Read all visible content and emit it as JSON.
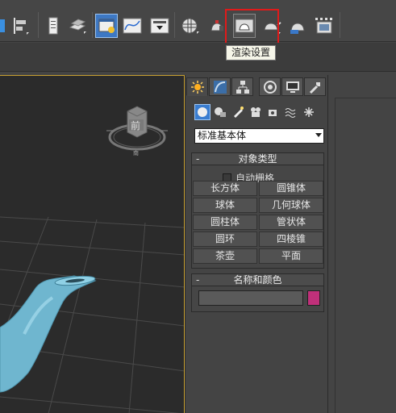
{
  "toolbar": {
    "tooltip": "渲染设置",
    "icons": [
      "align-icon",
      "layer-manager-icon",
      "scene-explorer-icon",
      "material-editor-icon",
      "curve-editor-icon",
      "schematic-view-icon",
      "render-setup-icon",
      "rendered-frame-icon",
      "render-production-icon",
      "teapot-render-icon",
      "render-frame-window-icon"
    ]
  },
  "viewport": {
    "viewcube_label": "前",
    "compass_label": "南"
  },
  "command_panel": {
    "tabs": [
      "create-tab",
      "modify-tab",
      "hierarchy-tab",
      "motion-tab",
      "display-tab",
      "utilities-tab"
    ],
    "category": "标准基本体",
    "object_type": {
      "title": "对象类型",
      "minus": "-",
      "autogrid": "自动栅格",
      "buttons": [
        "长方体",
        "圆锥体",
        "球体",
        "几何球体",
        "圆柱体",
        "管状体",
        "圆环",
        "四棱锥",
        "茶壶",
        "平面"
      ]
    },
    "name_color": {
      "title": "名称和颜色",
      "minus": "-",
      "name_value": "",
      "color": "#c0307a"
    }
  },
  "colors": {
    "highlight": "#e01a1a",
    "viewport_border": "#c8a032",
    "accent_blue": "#4a8fd8"
  }
}
